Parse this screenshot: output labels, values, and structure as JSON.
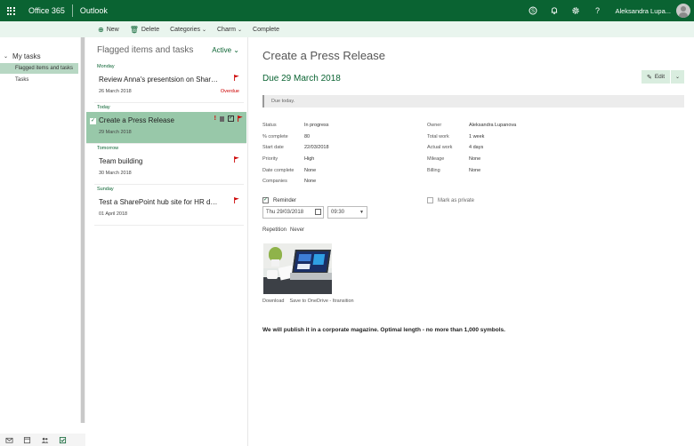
{
  "topbar": {
    "brand": "Office 365",
    "app": "Outlook",
    "user_name": "Aleksandra Lupa...",
    "icons": [
      "skype-icon",
      "bell-icon",
      "gear-icon",
      "help-icon"
    ]
  },
  "colors": {
    "brand_green": "#0a6332",
    "command_bar": "#e9f5ee",
    "selected_task": "#98c8a9",
    "selected_nav": "#b7d7c3",
    "flag_red": "#c00000"
  },
  "commands": {
    "new": "New",
    "delete": "Delete",
    "categories": "Categories",
    "charm": "Charm",
    "complete": "Complete"
  },
  "nav": {
    "header": "My tasks",
    "items": [
      {
        "label": "Flagged items and tasks",
        "selected": true
      },
      {
        "label": "Tasks",
        "selected": false
      }
    ]
  },
  "tasklist": {
    "title": "Flagged items and tasks",
    "filter": "Active",
    "groups": [
      {
        "label": "Monday",
        "tasks": [
          {
            "title": "Review Anna's presentsion on Share...",
            "date": "26 March 2018",
            "status": "Overdue"
          }
        ]
      },
      {
        "label": "Today",
        "tasks": [
          {
            "title": "Create a Press Release",
            "date": "29 March 2018",
            "status": ""
          }
        ]
      },
      {
        "label": "Tomorrow",
        "tasks": [
          {
            "title": "Team building",
            "date": "30 March 2018",
            "status": ""
          }
        ]
      },
      {
        "label": "Sunday",
        "tasks": [
          {
            "title": "Test a SharePoint hub site for HR de...",
            "date": "01 April 2018",
            "status": ""
          }
        ]
      }
    ]
  },
  "detail": {
    "title": "Create a Press Release",
    "due": "Due 29 March 2018",
    "edit_label": "Edit",
    "info": "Due today.",
    "props_left": [
      {
        "label": "Status",
        "value": "In progress"
      },
      {
        "label": "% complete",
        "value": "80"
      },
      {
        "label": "Start date",
        "value": "22/03/2018"
      },
      {
        "label": "Priority",
        "value": "High"
      },
      {
        "label": "Date complete",
        "value": "None"
      },
      {
        "label": "Companies",
        "value": "None"
      }
    ],
    "props_right": [
      {
        "label": "Owner",
        "value": "Aleksandra Lupanova"
      },
      {
        "label": "Total work",
        "value": "1 week"
      },
      {
        "label": "Actual work",
        "value": "4 days"
      },
      {
        "label": "Mileage",
        "value": "None"
      },
      {
        "label": "Billing",
        "value": "None"
      }
    ],
    "reminder_label": "Reminder",
    "reminder_checked": true,
    "private_label": "Mark as private",
    "reminder_date": "Thu 29/03/2018",
    "reminder_time": "09:30",
    "repetition_label": "Repetition",
    "repetition_value": "Never",
    "download_label": "Download",
    "save_label": "Save to OneDrive - Itransition",
    "note": "We will publish it in a corporate magazine. Optimal length - no more than 1,000 symbols."
  }
}
